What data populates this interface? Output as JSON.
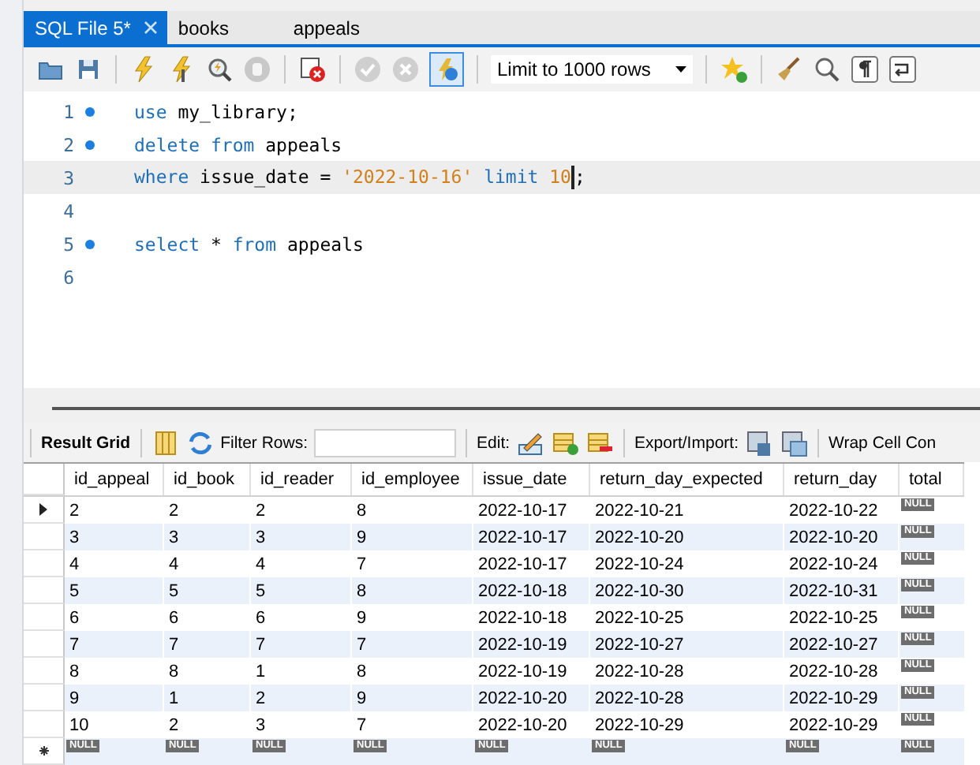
{
  "tabs": [
    {
      "label": "SQL File 5*",
      "selected": true,
      "closable": true
    },
    {
      "label": "books",
      "selected": false,
      "closable": false
    },
    {
      "label": "appeals",
      "selected": false,
      "closable": false
    }
  ],
  "toolbar": {
    "limit": "Limit to 1000 rows",
    "autocommit_on": true
  },
  "editor": {
    "lines": [
      {
        "number": "1",
        "marker": true,
        "current": false,
        "tokens": [
          {
            "kind": "keyword",
            "text": "use"
          },
          {
            "kind": "ident",
            "text": " my_library;"
          }
        ]
      },
      {
        "number": "2",
        "marker": true,
        "current": false,
        "tokens": [
          {
            "kind": "keyword",
            "text": "delete"
          },
          {
            "kind": "keyword",
            "text": " from"
          },
          {
            "kind": "ident",
            "text": " appeals"
          }
        ]
      },
      {
        "number": "3",
        "marker": false,
        "current": true,
        "tokens": [
          {
            "kind": "keyword",
            "text": "where"
          },
          {
            "kind": "ident",
            "text": " issue_date = "
          },
          {
            "kind": "string",
            "text": "'2022-10-16'"
          },
          {
            "kind": "keyword",
            "text": " limit"
          },
          {
            "kind": "number",
            "text": " 10",
            "caret_after": true
          },
          {
            "kind": "ident",
            "text": ";"
          }
        ]
      },
      {
        "number": "4",
        "marker": false,
        "current": false
      },
      {
        "number": "5",
        "marker": true,
        "current": false,
        "tokens": [
          {
            "kind": "keyword",
            "text": "select"
          },
          {
            "kind": "ident",
            "text": " * "
          },
          {
            "kind": "keyword",
            "text": "from"
          },
          {
            "kind": "ident",
            "text": " appeals"
          }
        ]
      },
      {
        "number": "6",
        "marker": false,
        "current": false
      }
    ]
  },
  "result_toolbar": {
    "title": "Result Grid",
    "filter_label": "Filter Rows:",
    "edit_label": "Edit:",
    "export_label": "Export/Import:",
    "wrap_label": "Wrap Cell Con"
  },
  "grid": {
    "columns": [
      "id_appeal",
      "id_book",
      "id_reader",
      "id_employee",
      "issue_date",
      "return_day_expected",
      "return_day",
      "total"
    ],
    "rows": [
      {
        "selected": true,
        "new": false,
        "cells": [
          "2",
          "2",
          "2",
          "8",
          "2022-10-17",
          "2022-10-21",
          "2022-10-22",
          {
            "null": "NULL"
          }
        ]
      },
      {
        "selected": false,
        "new": false,
        "cells": [
          "3",
          "3",
          "3",
          "9",
          "2022-10-17",
          "2022-10-20",
          "2022-10-20",
          {
            "null": "NULL"
          }
        ]
      },
      {
        "selected": false,
        "new": false,
        "cells": [
          "4",
          "4",
          "4",
          "7",
          "2022-10-17",
          "2022-10-24",
          "2022-10-24",
          {
            "null": "NULL"
          }
        ]
      },
      {
        "selected": false,
        "new": false,
        "cells": [
          "5",
          "5",
          "5",
          "8",
          "2022-10-18",
          "2022-10-30",
          "2022-10-31",
          {
            "null": "NULL"
          }
        ]
      },
      {
        "selected": false,
        "new": false,
        "cells": [
          "6",
          "6",
          "6",
          "9",
          "2022-10-18",
          "2022-10-25",
          "2022-10-25",
          {
            "null": "NULL"
          }
        ]
      },
      {
        "selected": false,
        "new": false,
        "cells": [
          "7",
          "7",
          "7",
          "7",
          "2022-10-19",
          "2022-10-27",
          "2022-10-27",
          {
            "null": "NULL"
          }
        ]
      },
      {
        "selected": false,
        "new": false,
        "cells": [
          "8",
          "8",
          "1",
          "8",
          "2022-10-19",
          "2022-10-28",
          "2022-10-28",
          {
            "null": "NULL"
          }
        ]
      },
      {
        "selected": false,
        "new": false,
        "cells": [
          "9",
          "1",
          "2",
          "9",
          "2022-10-20",
          "2022-10-28",
          "2022-10-29",
          {
            "null": "NULL"
          }
        ]
      },
      {
        "selected": false,
        "new": false,
        "cells": [
          "10",
          "2",
          "3",
          "7",
          "2022-10-20",
          "2022-10-29",
          "2022-10-29",
          {
            "null": "NULL"
          }
        ]
      },
      {
        "selected": false,
        "new": true,
        "cells": [
          {
            "null": "NULL"
          },
          {
            "null": "NULL"
          },
          {
            "null": "NULL"
          },
          {
            "null": "NULL"
          },
          {
            "null": "NULL"
          },
          {
            "null": "NULL"
          },
          {
            "null": "NULL"
          },
          {
            "null": "NULL"
          }
        ]
      }
    ]
  }
}
